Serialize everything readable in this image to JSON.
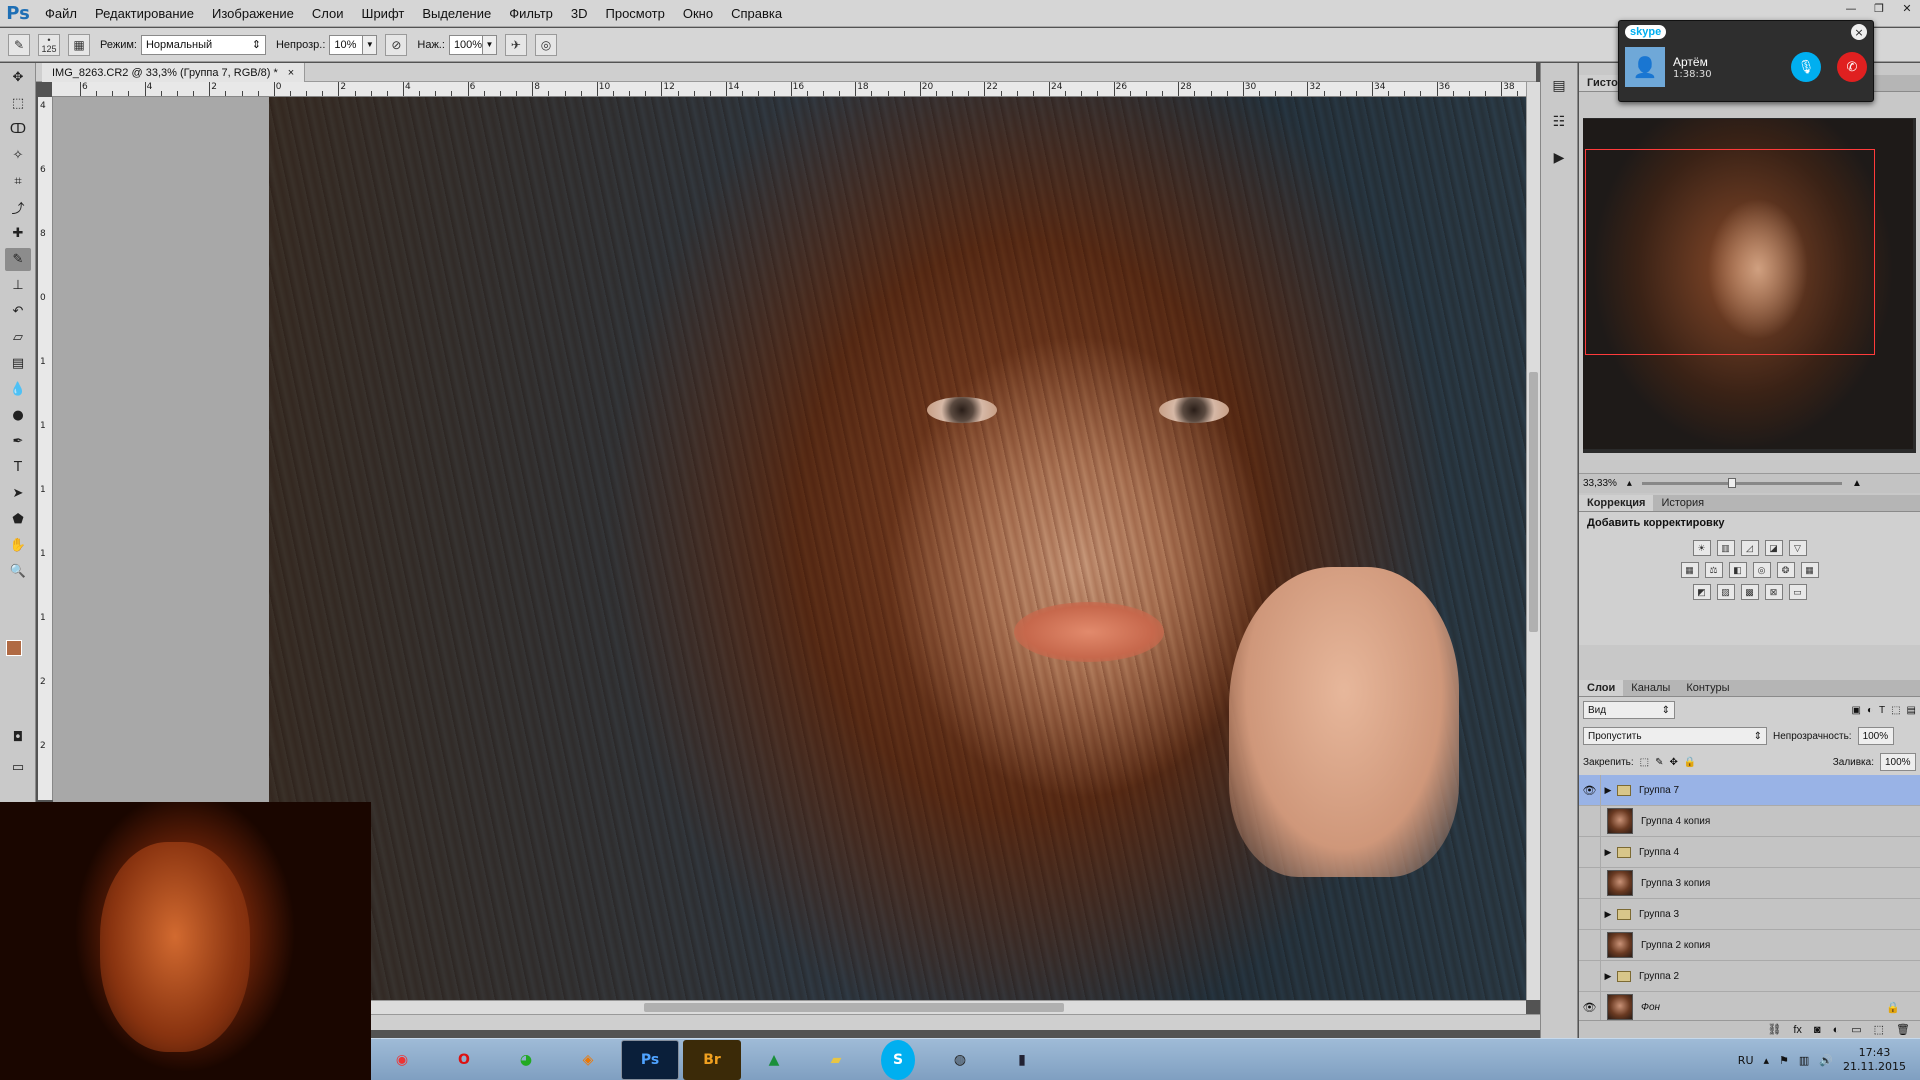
{
  "menubar": {
    "logo": "Ps",
    "items": [
      "Файл",
      "Редактирование",
      "Изображение",
      "Слои",
      "Шрифт",
      "Выделение",
      "Фильтр",
      "3D",
      "Просмотр",
      "Окно",
      "Справка"
    ]
  },
  "optionsbar": {
    "brush_size": "125",
    "mode_label": "Режим:",
    "mode_value": "Нормальный",
    "opacity_label": "Непрозр.:",
    "opacity_value": "10%",
    "flow_label": "Наж.:",
    "flow_value": "100%"
  },
  "document": {
    "tab_title": "IMG_8263.CR2 @ 33,3% (Группа 7, RGB/8) *",
    "close": "×"
  },
  "ruler": {
    "h_numbers": [
      "6",
      "4",
      "2",
      "0",
      "2",
      "4",
      "6",
      "8",
      "10",
      "12",
      "14",
      "16",
      "18",
      "20",
      "22",
      "24",
      "26",
      "28",
      "30",
      "32",
      "34",
      "36",
      "38"
    ],
    "v_numbers": [
      "4",
      "6",
      "8",
      "0",
      "1",
      "1",
      "1",
      "1",
      "1",
      "2",
      "2",
      "2"
    ]
  },
  "skype": {
    "logo": "skype",
    "caller": "Артём",
    "duration": "1:38:30",
    "close": "×"
  },
  "navigator": {
    "tabs": [
      "Гисто"
    ],
    "zoom": "33,33%"
  },
  "corrections": {
    "tabs": [
      "Коррекция",
      "История"
    ],
    "title": "Добавить корректировку"
  },
  "layers": {
    "tabs": [
      "Слои",
      "Каналы",
      "Контуры"
    ],
    "filter_label": "Вид",
    "blend_mode": "Пропустить",
    "opacity_label": "Непрозрачность:",
    "opacity_value": "100%",
    "lock_label": "Закрепить:",
    "fill_label": "Заливка:",
    "fill_value": "100%",
    "items": [
      {
        "name": "Группа 7",
        "type": "group",
        "visible": true,
        "selected": true
      },
      {
        "name": "Группа 4 копия",
        "type": "layer",
        "visible": false,
        "selected": false
      },
      {
        "name": "Группа 4",
        "type": "group",
        "visible": false,
        "selected": false
      },
      {
        "name": "Группа 3 копия",
        "type": "layer",
        "visible": false,
        "selected": false
      },
      {
        "name": "Группа 3",
        "type": "group",
        "visible": false,
        "selected": false
      },
      {
        "name": "Группа 2 копия",
        "type": "layer",
        "visible": false,
        "selected": false
      },
      {
        "name": "Группа 2",
        "type": "group",
        "visible": false,
        "selected": false
      },
      {
        "name": "Фон",
        "type": "layer",
        "visible": true,
        "selected": false,
        "locked": true
      }
    ]
  },
  "taskbar": {
    "apps": [
      "chrome-icon",
      "opera-icon",
      "media-icon",
      "eye-icon",
      "Ps",
      "Br",
      "drive-icon",
      "folder-icon",
      "S",
      "camera-icon",
      "phone-icon"
    ],
    "lang": "RU",
    "time": "17:43",
    "date": "21.11.2015"
  }
}
